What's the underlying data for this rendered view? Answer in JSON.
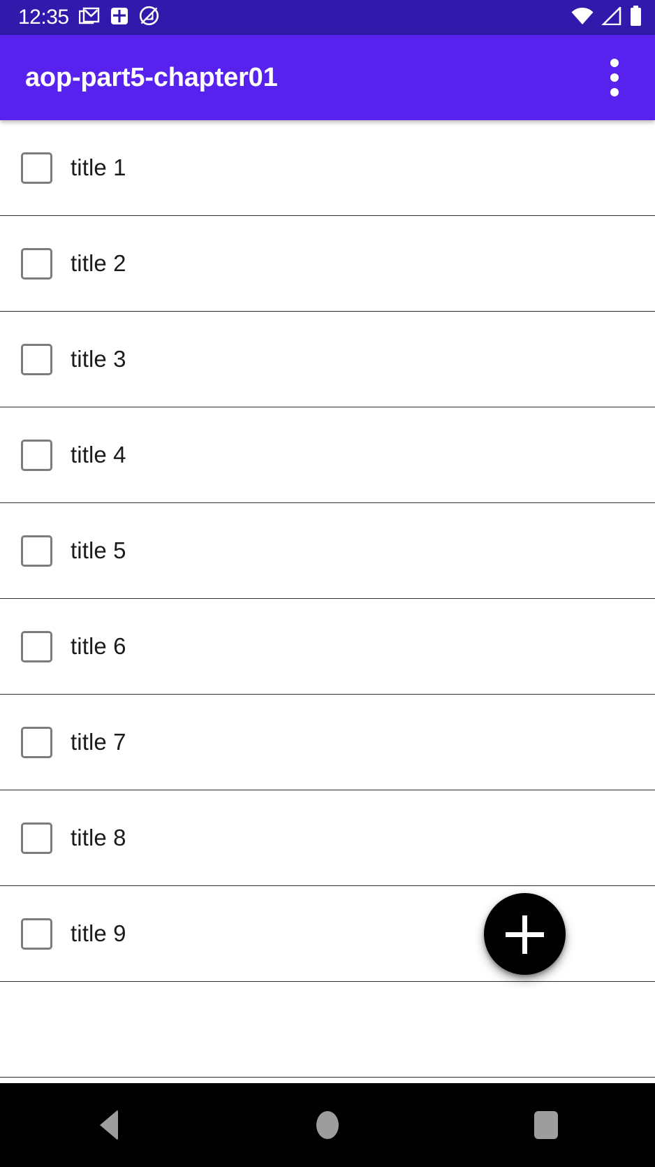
{
  "status_bar": {
    "time": "12:35",
    "background_color": "#3119AB",
    "left_icons": [
      {
        "name": "gmail-icon",
        "label": "Gmail"
      },
      {
        "name": "app-plus-square-icon",
        "label": "App notification"
      },
      {
        "name": "circle-arrow-icon",
        "label": "App notification"
      }
    ],
    "right_icons": [
      {
        "name": "wifi-icon",
        "label": "Wi-Fi"
      },
      {
        "name": "cellular-signal-icon",
        "label": "Cellular signal"
      },
      {
        "name": "battery-icon",
        "label": "Battery full"
      }
    ]
  },
  "app_bar": {
    "title": "aop-part5-chapter01",
    "background_color": "#5822EE",
    "title_color": "#FFFFFF",
    "overflow_label": "More options"
  },
  "list": {
    "items": [
      {
        "label": "title 1",
        "checked": false
      },
      {
        "label": "title 2",
        "checked": false
      },
      {
        "label": "title 3",
        "checked": false
      },
      {
        "label": "title 4",
        "checked": false
      },
      {
        "label": "title 5",
        "checked": false
      },
      {
        "label": "title 6",
        "checked": false
      },
      {
        "label": "title 7",
        "checked": false
      },
      {
        "label": "title 8",
        "checked": false
      },
      {
        "label": "title 9",
        "checked": false
      },
      {
        "label": "",
        "checked": false
      }
    ]
  },
  "fab": {
    "icon": "plus-icon",
    "label": "Add",
    "background_color": "#000000",
    "icon_color": "#FFFFFF"
  },
  "navigation_bar": {
    "background_color": "#000000",
    "icon_color": "#9D9D9D",
    "buttons": [
      {
        "name": "nav-back-button",
        "label": "Back"
      },
      {
        "name": "nav-home-button",
        "label": "Home"
      },
      {
        "name": "nav-recents-button",
        "label": "Recents"
      }
    ]
  }
}
